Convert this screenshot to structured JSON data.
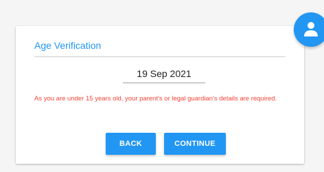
{
  "card": {
    "title": "Age Verification",
    "date_value": "19 Sep 2021",
    "message": "As you are under 15 years old, your parent's or legal guardian's details are required."
  },
  "buttons": {
    "back_label": "BACK",
    "continue_label": "CONTINUE"
  },
  "avatar": {
    "icon": "person-icon"
  },
  "colors": {
    "accent": "#2196f3",
    "error": "#f44336",
    "background": "#f5f5f5"
  }
}
